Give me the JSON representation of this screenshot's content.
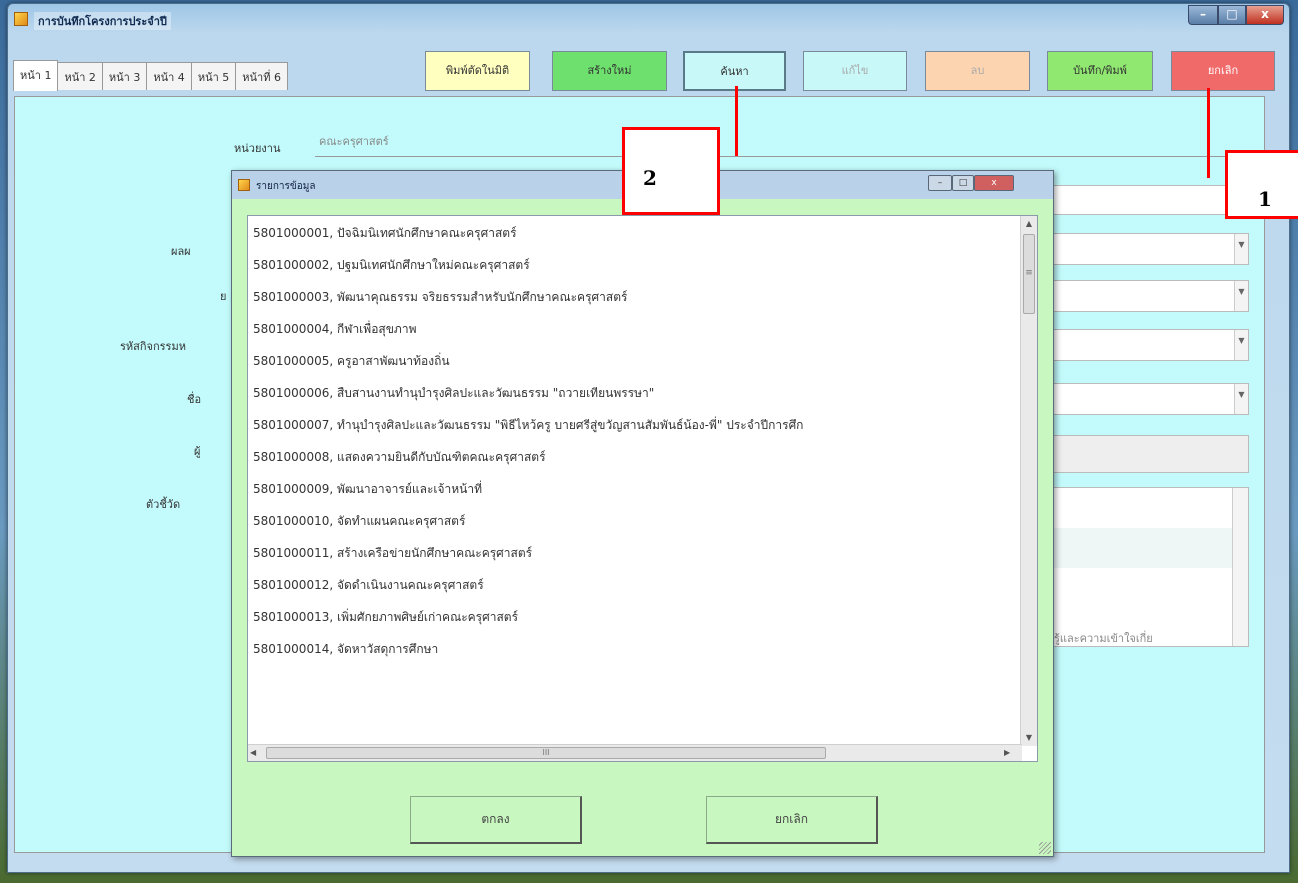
{
  "window": {
    "title": "การบันทึกโครงการประจำปี",
    "controls": {
      "minimize": "–",
      "maximize": "□",
      "close": "x"
    }
  },
  "tabs": [
    {
      "label": "หน้า 1"
    },
    {
      "label": "หน้า 2"
    },
    {
      "label": "หน้า 3"
    },
    {
      "label": "หน้า 4"
    },
    {
      "label": "หน้า 5"
    },
    {
      "label": "หน้าที่ 6"
    }
  ],
  "toolbar": {
    "print_all": "พิมพ์ตัดในมิติ",
    "create": "สร้างใหม่",
    "search": "ค้นหา",
    "edit": "แก้ไข",
    "delete": "ลบ",
    "save_print": "บันทึก/พิมพ์",
    "cancel": "ยกเลิก"
  },
  "colors": {
    "print_all": "#ffffc0",
    "create": "#6ee06e",
    "search": "#c8f8f8",
    "edit": "#c8f8f8",
    "delete": "#fcd4b0",
    "save_print": "#90e870",
    "cancel": "#f06a6a"
  },
  "form": {
    "unit_label": "หน่วยงาน",
    "unit_value": "คณะครุศาสตร์",
    "labels": [
      "ผลผ",
      "ย",
      "รหัสกิจกรรมห",
      "ชื่อ",
      "ผู้",
      "ตัวชี้วัด"
    ],
    "indicator_partial": "รู้และความเข้าใจเกี่ย"
  },
  "dialog": {
    "title": "รายการข้อมูล",
    "items": [
      "5801000001, ปัจฉิมนิเทศนักศึกษาคณะครุศาสตร์",
      "5801000002, ปฐมนิเทศนักศึกษาใหม่คณะครุศาสตร์",
      "5801000003, พัฒนาคุณธรรม จริยธรรมสำหรับนักศึกษาคณะครุศาสตร์",
      "5801000004, กีฬาเพื่อสุขภาพ",
      "5801000005, ครูอาสาพัฒนาท้องถิ่น",
      "5801000006, สืบสานงานทำนุบำรุงศิลปะและวัฒนธรรม \"ถวายเทียนพรรษา\"",
      "5801000007, ทำนุบำรุงศิลปะและวัฒนธรรม \"พิธีไหว้ครู บายศรีสู่ขวัญสานสัมพันธ์น้อง-พี่\" ประจำปีการศึก",
      "5801000008, แสดงความยินดีกับบัณฑิตคณะครุศาสตร์",
      "5801000009, พัฒนาอาจารย์และเจ้าหน้าที่",
      "5801000010, จัดทำแผนคณะครุศาสตร์",
      "5801000011, สร้างเครือข่ายนักศึกษาคณะครุศาสตร์",
      "5801000012, จัดดำเนินงานคณะครุศาสตร์",
      "5801000013, เพิ่มศักยภาพศิษย์เก่าคณะครุศาสตร์",
      "5801000014, จัดหาวัสดุการศึกษา"
    ],
    "ok": "ตกลง",
    "cancel": "ยกเลิก",
    "scroll_mark": "≡",
    "hscroll_mark": "III"
  },
  "callouts": {
    "one": "1",
    "two": "2"
  }
}
